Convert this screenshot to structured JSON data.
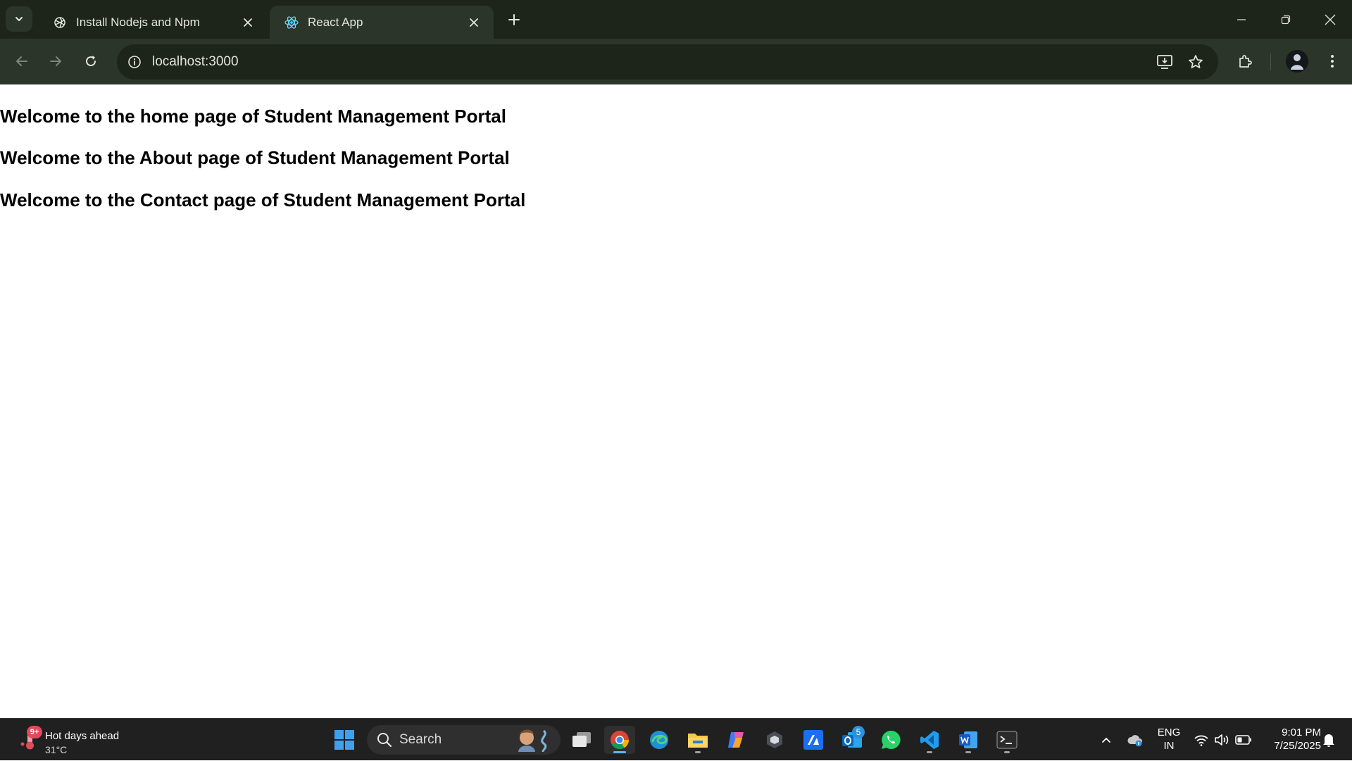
{
  "browser": {
    "tabs": [
      {
        "title": "Install Nodejs and Npm",
        "icon": "openai-icon",
        "active": false
      },
      {
        "title": "React App",
        "icon": "react-icon",
        "active": true
      }
    ],
    "address": "localhost:3000"
  },
  "page": {
    "headings": [
      "Welcome to the home page of Student Management Portal",
      "Welcome to the About page of Student Management Portal",
      "Welcome to the Contact page of Student Management Portal"
    ]
  },
  "taskbar": {
    "weather": {
      "title": "Hot days ahead",
      "temp": "31°C",
      "badge": "9+"
    },
    "search_label": "Search",
    "outlook_badge": "5",
    "pinned_apps": [
      "start-icon",
      "task-view-icon",
      "chrome-icon",
      "edge-icon",
      "file-explorer-icon",
      "copilot-icon",
      "app-icon",
      "app-icon",
      "outlook-icon",
      "whatsapp-icon",
      "vscode-icon",
      "word-icon",
      "terminal-icon"
    ],
    "language": {
      "line1": "ENG",
      "line2": "IN"
    },
    "clock": {
      "time": "9:01 PM",
      "date": "7/25/2025"
    }
  },
  "colors": {
    "browser_frame": "#1d2419",
    "toolbar": "#2c3529",
    "taskbar": "#202020"
  }
}
